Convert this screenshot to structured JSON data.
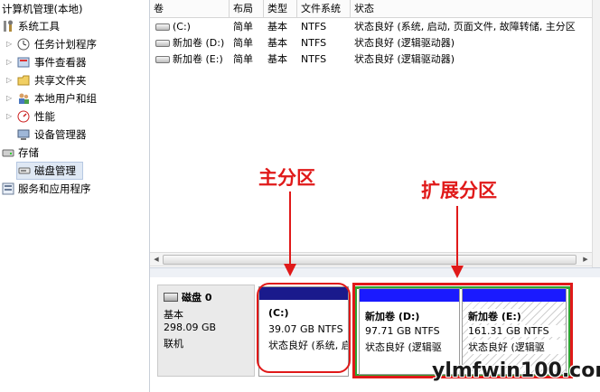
{
  "tree": {
    "root": "计算机管理(本地)",
    "items": [
      {
        "label": "系统工具",
        "icon": "tools-icon"
      },
      {
        "label": "任务计划程序",
        "icon": "clock-icon"
      },
      {
        "label": "事件查看器",
        "icon": "event-viewer-icon"
      },
      {
        "label": "共享文件夹",
        "icon": "folder-icon"
      },
      {
        "label": "本地用户和组",
        "icon": "users-icon"
      },
      {
        "label": "性能",
        "icon": "performance-icon"
      },
      {
        "label": "设备管理器",
        "icon": "device-manager-icon"
      },
      {
        "label": "存储",
        "icon": "storage-icon"
      },
      {
        "label": "磁盘管理",
        "icon": "disk-icon"
      },
      {
        "label": "服务和应用程序",
        "icon": "services-icon"
      }
    ]
  },
  "table": {
    "headers": [
      "卷",
      "布局",
      "类型",
      "文件系统",
      "状态"
    ],
    "rows": [
      {
        "vol": "(C:)",
        "layout": "简单",
        "type": "基本",
        "fs": "NTFS",
        "status": "状态良好 (系统, 启动, 页面文件, 故障转储, 主分区"
      },
      {
        "vol": "新加卷 (D:)",
        "layout": "简单",
        "type": "基本",
        "fs": "NTFS",
        "status": "状态良好 (逻辑驱动器)"
      },
      {
        "vol": "新加卷 (E:)",
        "layout": "简单",
        "type": "基本",
        "fs": "NTFS",
        "status": "状态良好 (逻辑驱动器)"
      }
    ]
  },
  "disk": {
    "name": "磁盘 0",
    "type": "基本",
    "size": "298.09 GB",
    "status": "联机",
    "partitions": [
      {
        "label": "(C:)",
        "size": "39.07 GB NTFS",
        "status": "状态良好 (系统, 启"
      },
      {
        "label": "新加卷  (D:)",
        "size": "97.71 GB NTFS",
        "status": "状态良好 (逻辑驱"
      },
      {
        "label": "新加卷  (E:)",
        "size": "161.31 GB NTFS",
        "status": "状态良好 (逻辑驱"
      }
    ]
  },
  "annotations": {
    "primary": "主分区",
    "extended": "扩展分区"
  },
  "watermark": "ylmfwin100.com",
  "colors": {
    "primary_bar": "#1a1a8c",
    "logical_bar": "#1a1aff",
    "extended_frame": "#2fa531",
    "annotation_red": "#e01919"
  }
}
